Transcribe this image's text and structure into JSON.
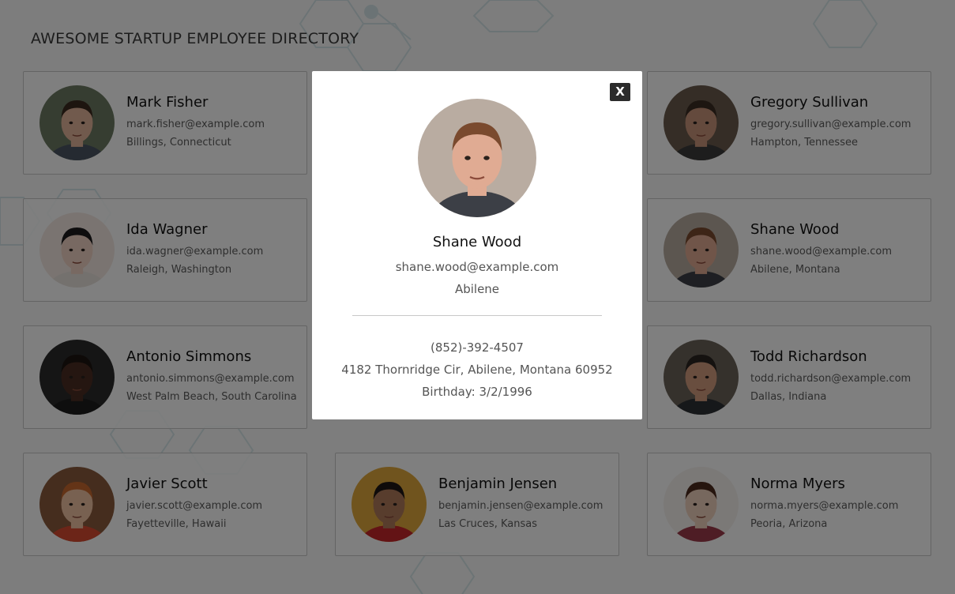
{
  "page": {
    "title": "AWESOME STARTUP EMPLOYEE DIRECTORY"
  },
  "employees": [
    {
      "name": "Mark Fisher",
      "email": "mark.fisher@example.com",
      "location": "Billings, Connecticut",
      "skin": "#e3b59b",
      "hair": "#3b2a1e",
      "bg": "#6d7a63",
      "shirt": "#4a5563"
    },
    {
      "name": "",
      "email": "",
      "location": "",
      "skin": "",
      "hair": "",
      "bg": "",
      "shirt": ""
    },
    {
      "name": "Gregory Sullivan",
      "email": "gregory.sullivan@example.com",
      "location": "Hampton, Tennessee",
      "skin": "#c8957a",
      "hair": "#3a2c22",
      "bg": "#6a5b4d",
      "shirt": "#3a3a3a"
    },
    {
      "name": "Ida Wagner",
      "email": "ida.wagner@example.com",
      "location": "Raleigh, Washington",
      "skin": "#f1d2c4",
      "hair": "#1d1a1c",
      "bg": "#f4e9e3",
      "shirt": "#e9e2dd"
    },
    {
      "name": "",
      "email": "",
      "location": "",
      "skin": "",
      "hair": "",
      "bg": "",
      "shirt": ""
    },
    {
      "name": "Shane Wood",
      "email": "shane.wood@example.com",
      "location": "Abilene, Montana",
      "skin": "#e0ab93",
      "hair": "#7a4a2e",
      "bg": "#b9aca1",
      "shirt": "#3c3f46"
    },
    {
      "name": "Antonio Simmons",
      "email": "antonio.simmons@example.com",
      "location": "West Palm Beach, South Carolina",
      "skin": "#4a2d22",
      "hair": "#1c1411",
      "bg": "#2b2b2b",
      "shirt": "#1d1d1d"
    },
    {
      "name": "",
      "email": "",
      "location": "",
      "skin": "",
      "hair": "",
      "bg": "",
      "shirt": ""
    },
    {
      "name": "Todd Richardson",
      "email": "todd.richardson@example.com",
      "location": "Dallas, Indiana",
      "skin": "#d39c7f",
      "hair": "#2b2420",
      "bg": "#6b6258",
      "shirt": "#2d3035"
    },
    {
      "name": "Javier Scott",
      "email": "javier.scott@example.com",
      "location": "Fayetteville, Hawaii",
      "skin": "#f0c3a3",
      "hair": "#c9692f",
      "bg": "#8a5a3c",
      "shirt": "#d84a31"
    },
    {
      "name": "Benjamin Jensen",
      "email": "benjamin.jensen@example.com",
      "location": "Las Cruces, Kansas",
      "skin": "#b07a5a",
      "hair": "#1e1714",
      "bg": "#e1a93c",
      "shirt": "#c7272a"
    },
    {
      "name": "Norma Myers",
      "email": "norma.myers@example.com",
      "location": "Peoria, Arizona",
      "skin": "#efd0bd",
      "hair": "#4c2a1c",
      "bg": "#f6f2ef",
      "shirt": "#9c3b4a"
    }
  ],
  "modal": {
    "close_label": "X",
    "name": "Shane Wood",
    "email": "shane.wood@example.com",
    "city": "Abilene",
    "phone": "(852)-392-4507",
    "address": "4182 Thornridge Cir, Abilene, Montana 60952",
    "birthday": "Birthday: 3/2/1996",
    "skin": "#e0ab93",
    "hair": "#7a4a2e",
    "bg": "#b9aca1",
    "shirt": "#3c3f46"
  },
  "colors": {
    "overlay": "rgba(0,0,0,0.5)",
    "card_border": "#c9c9c9",
    "close_bg": "#2c2c2c"
  }
}
